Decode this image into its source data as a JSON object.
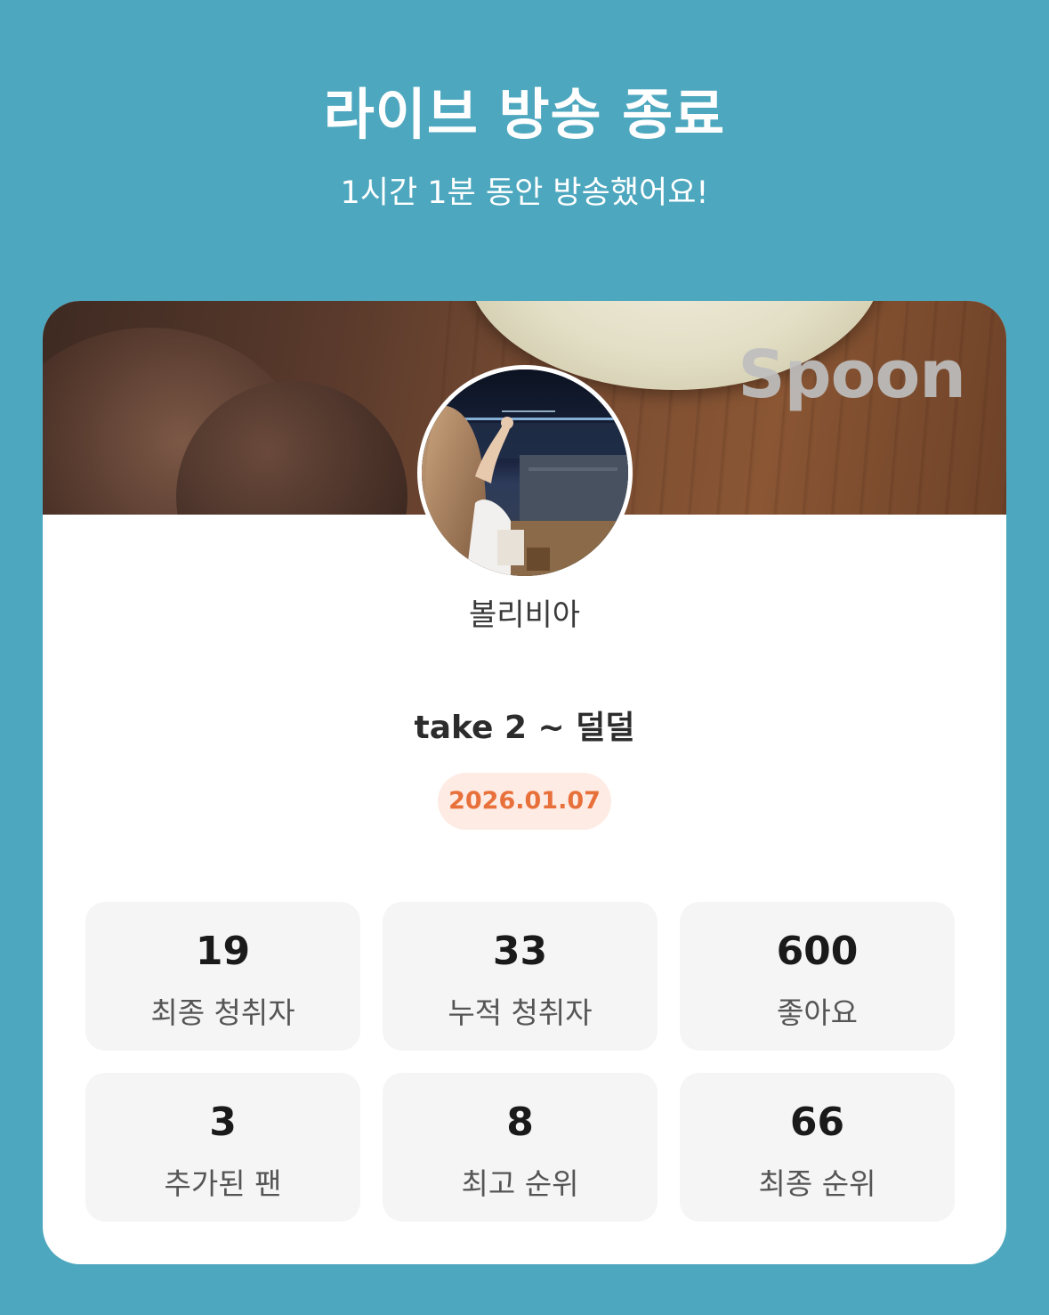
{
  "header": {
    "title": "라이브 방송 종료",
    "subtitle": "1시간 1분 동안 방송했어요!"
  },
  "card": {
    "logo_text": "Spoon",
    "username": "볼리비아",
    "broadcast_title": "take 2 ~ 덜덜",
    "date": "2026.01.07"
  },
  "stats": [
    {
      "value": "19",
      "label": "최종 청취자"
    },
    {
      "value": "33",
      "label": "누적 청취자"
    },
    {
      "value": "600",
      "label": "좋아요"
    },
    {
      "value": "3",
      "label": "추가된 팬"
    },
    {
      "value": "8",
      "label": "최고 순위"
    },
    {
      "value": "66",
      "label": "최종 순위"
    }
  ],
  "colors": {
    "background": "#4da7be",
    "date_text": "#e8703a",
    "date_badge_bg": "#fdebe4",
    "stat_box_bg": "#f5f5f5"
  }
}
